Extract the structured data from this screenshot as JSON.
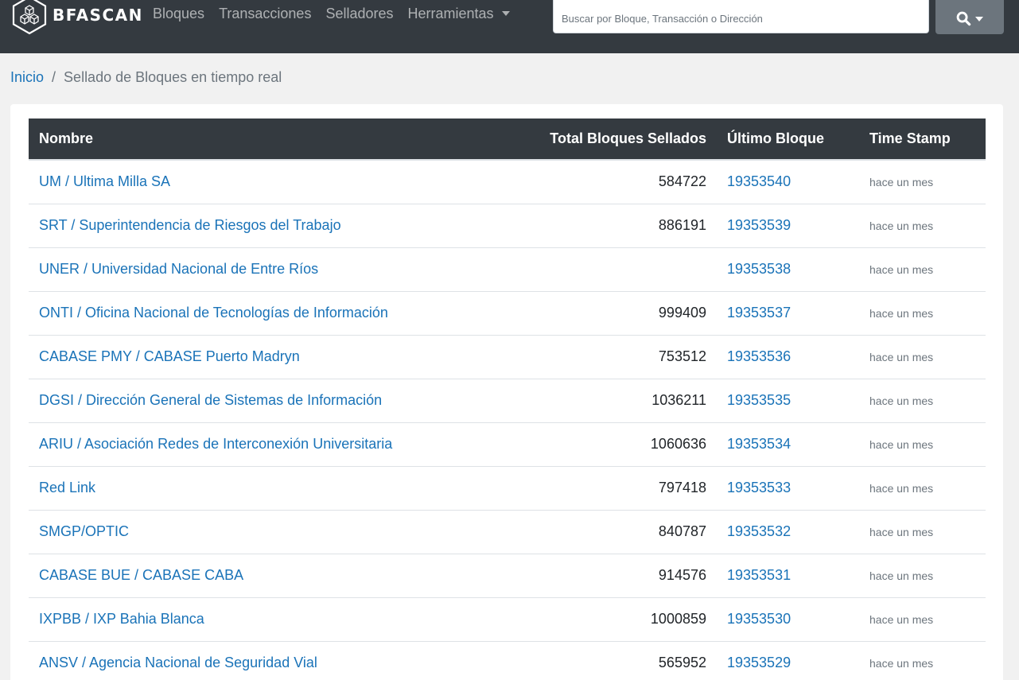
{
  "brand": {
    "name": "BFASCAN",
    "logo_icon": "cubes-hexagon-icon"
  },
  "nav": {
    "items": [
      {
        "label": "Bloques"
      },
      {
        "label": "Transacciones"
      },
      {
        "label": "Selladores"
      },
      {
        "label": "Herramientas"
      }
    ]
  },
  "search": {
    "placeholder": "Buscar por Bloque, Transacción o Dirección",
    "button_icon": "search-icon"
  },
  "breadcrumb": {
    "home": "Inicio",
    "separator": "/",
    "current": "Sellado de Bloques en tiempo real"
  },
  "table": {
    "headers": {
      "name": "Nombre",
      "total": "Total Bloques Sellados",
      "block": "Último Bloque",
      "timestamp": "Time Stamp"
    },
    "rows": [
      {
        "name": "UM / Ultima Milla SA",
        "total": "584722",
        "block": "19353540",
        "timestamp": "hace un mes"
      },
      {
        "name": "SRT / Superintendencia de Riesgos del Trabajo",
        "total": "886191",
        "block": "19353539",
        "timestamp": "hace un mes"
      },
      {
        "name": "UNER / Universidad Nacional de Entre Ríos",
        "total": "",
        "block": "19353538",
        "timestamp": "hace un mes"
      },
      {
        "name": "ONTI / Oficina Nacional de Tecnologías de Información",
        "total": "999409",
        "block": "19353537",
        "timestamp": "hace un mes"
      },
      {
        "name": "CABASE PMY / CABASE Puerto Madryn",
        "total": "753512",
        "block": "19353536",
        "timestamp": "hace un mes"
      },
      {
        "name": "DGSI / Dirección General de Sistemas de Información",
        "total": "1036211",
        "block": "19353535",
        "timestamp": "hace un mes"
      },
      {
        "name": "ARIU / Asociación Redes de Interconexión Universitaria",
        "total": "1060636",
        "block": "19353534",
        "timestamp": "hace un mes"
      },
      {
        "name": "Red Link",
        "total": "797418",
        "block": "19353533",
        "timestamp": "hace un mes"
      },
      {
        "name": "SMGP/OPTIC",
        "total": "840787",
        "block": "19353532",
        "timestamp": "hace un mes"
      },
      {
        "name": "CABASE BUE / CABASE CABA",
        "total": "914576",
        "block": "19353531",
        "timestamp": "hace un mes"
      },
      {
        "name": "IXPBB / IXP Bahia Blanca",
        "total": "1000859",
        "block": "19353530",
        "timestamp": "hace un mes"
      },
      {
        "name": "ANSV / Agencia Nacional de Seguridad Vial",
        "total": "565952",
        "block": "19353529",
        "timestamp": "hace un mes"
      }
    ]
  }
}
